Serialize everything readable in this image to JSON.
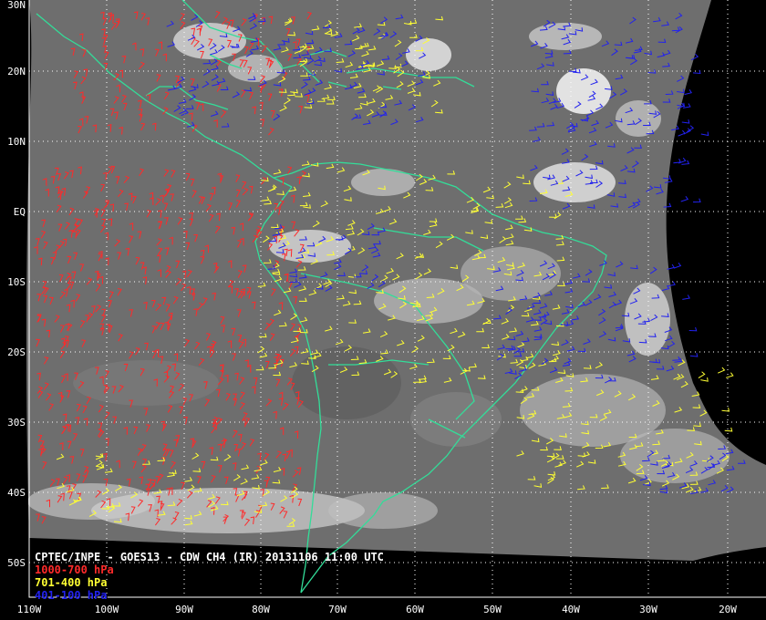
{
  "title": "CPTEC/INPE - GOES13 - CDW CH4 (IR) 20131106 11:00 UTC",
  "legend": [
    {
      "label": "1000-700 hPa",
      "color": "#ff2a2a"
    },
    {
      "label": "701-400 hPa",
      "color": "#ffff33"
    },
    {
      "label": "401-100 hPa",
      "color": "#2222ee"
    }
  ],
  "colors": {
    "coastline": "#33dd99",
    "grid": "#ffffff",
    "space": "#000000",
    "satellite_gray": "#6e6e6e"
  },
  "lat_labels": [
    "30N",
    "20N",
    "10N",
    "EQ",
    "10S",
    "20S",
    "30S",
    "40S",
    "50S"
  ],
  "lon_labels": [
    "110W",
    "100W",
    "90W",
    "80W",
    "70W",
    "60W",
    "50W",
    "40W",
    "30W",
    "20W"
  ],
  "wind_layers": [
    {
      "name": "1000-700 hPa",
      "color": "#ff2a2a"
    },
    {
      "name": "701-400 hPa",
      "color": "#ffff33"
    },
    {
      "name": "401-100 hPa",
      "color": "#2222ee"
    }
  ]
}
